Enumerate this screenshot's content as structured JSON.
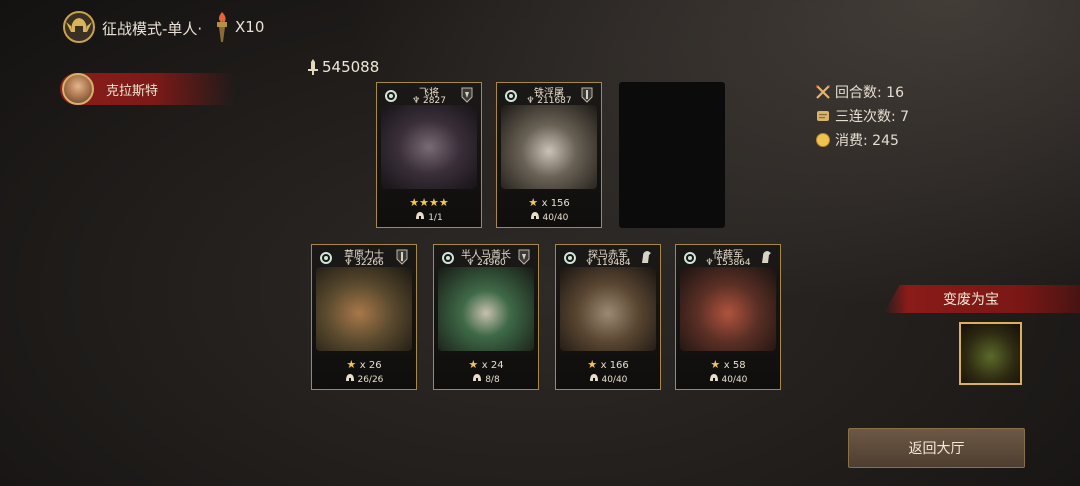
{
  "header": {
    "mode_title": "征战模式-单人·",
    "multiplier": "X10"
  },
  "player": {
    "name": "克拉斯特"
  },
  "total_power": "545088",
  "stats": {
    "rounds": "回合数: 16",
    "triple_count": "三连次数: 7",
    "cost": "消费: 245"
  },
  "top_row": [
    {
      "name": "飞将",
      "power": "2827",
      "stars_full": "★★★★",
      "star_count": "",
      "troops": "1/1"
    },
    {
      "name": "铁浮屠",
      "power": "211687",
      "stars_full": "★",
      "star_count": "x 156",
      "troops": "40/40"
    }
  ],
  "bottom_row": [
    {
      "name": "草原力士",
      "power": "32266",
      "stars_full": "★",
      "star_count": "x 26",
      "troops": "26/26"
    },
    {
      "name": "半人马酋长",
      "power": "24960",
      "stars_full": "★",
      "star_count": "x 24",
      "troops": "8/8"
    },
    {
      "name": "探马赤军",
      "power": "119484",
      "stars_full": "★",
      "star_count": "x 166",
      "troops": "40/40"
    },
    {
      "name": "怯薛军",
      "power": "153864",
      "stars_full": "★",
      "star_count": "x 58",
      "troops": "40/40"
    }
  ],
  "transform": {
    "label": "变废为宝"
  },
  "return_button": {
    "label": "返回大厅"
  },
  "colors": {
    "accent_red": "#8a1b18",
    "card_border": "#a88845",
    "star_gold": "#f3c84b"
  },
  "icons": {
    "mode": "helmet-emblem-icon",
    "multiplier": "torch-icon",
    "power": "sword-power-icon",
    "rounds": "crossed-swords-icon",
    "triple": "scroll-icon",
    "cost": "gold-coin-icon",
    "troops": "helmet-icon"
  }
}
